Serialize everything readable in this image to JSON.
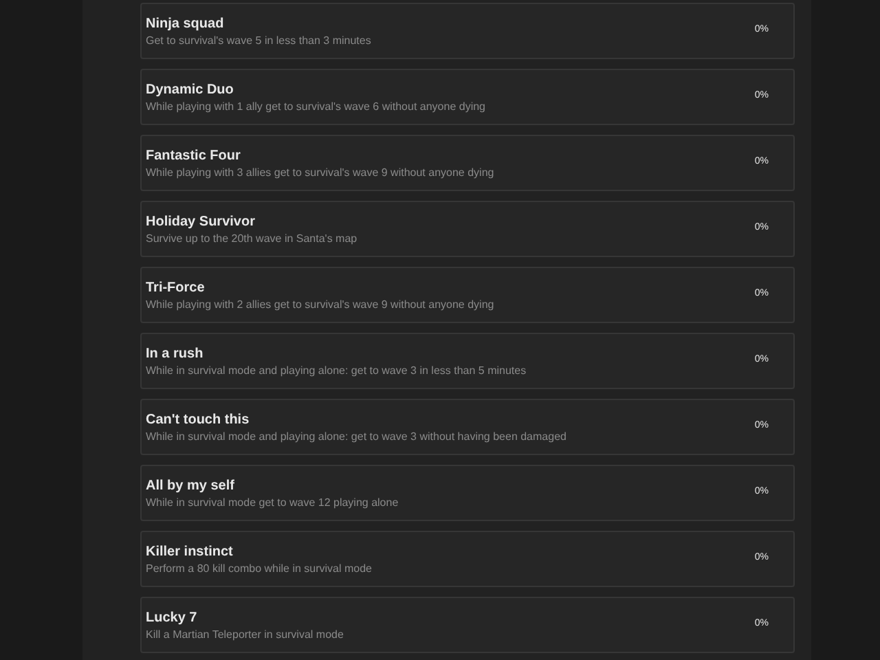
{
  "achievements": [
    {
      "title": "Ninja squad",
      "description": "Get to survival's wave 5 in less than 3 minutes",
      "progress": "0%"
    },
    {
      "title": "Dynamic Duo",
      "description": "While playing with 1 ally get to survival's wave 6 without anyone dying",
      "progress": "0%"
    },
    {
      "title": "Fantastic Four",
      "description": "While playing with 3 allies get to survival's wave 9 without anyone dying",
      "progress": "0%"
    },
    {
      "title": "Holiday Survivor",
      "description": "Survive up to the 20th wave in Santa's map",
      "progress": "0%"
    },
    {
      "title": "Tri-Force",
      "description": "While playing with 2 allies get to survival's wave 9 without anyone dying",
      "progress": "0%"
    },
    {
      "title": "In a rush",
      "description": "While in survival mode and playing alone: get to wave 3 in less than 5 minutes",
      "progress": "0%"
    },
    {
      "title": "Can't touch this",
      "description": "While in survival mode and playing alone: get to wave 3 without having been damaged",
      "progress": "0%"
    },
    {
      "title": "All by my self",
      "description": "While in survival mode get to wave 12 playing alone",
      "progress": "0%"
    },
    {
      "title": "Killer instinct",
      "description": "Perform a 80 kill combo while in survival mode",
      "progress": "0%"
    },
    {
      "title": "Lucky 7",
      "description": "Kill a Martian Teleporter in survival mode",
      "progress": "0%"
    }
  ]
}
